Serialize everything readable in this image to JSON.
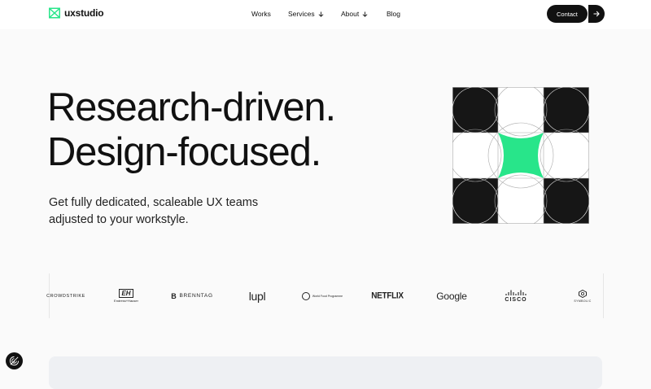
{
  "brand": {
    "name": "uxstudio",
    "accent_color": "#28e58a"
  },
  "nav": {
    "items": [
      {
        "label": "Works",
        "has_dropdown": false
      },
      {
        "label": "Services",
        "has_dropdown": true
      },
      {
        "label": "About",
        "has_dropdown": true
      },
      {
        "label": "Blog",
        "has_dropdown": false
      }
    ],
    "contact_label": "Contact",
    "contact_arrow_icon": "arrow-right-icon"
  },
  "hero": {
    "headline_line1": "Research-driven.",
    "headline_line2": "Design-focused.",
    "subtext": "Get fully dedicated, scaleable UX teams adjusted to your workstyle."
  },
  "client_logos": {
    "crowdstrike": "CROWDSTRIKE",
    "endress_mark": "EH",
    "endress": "Endress+Hauser",
    "brenntag": "BRENNTAG",
    "lupl": "lupl",
    "wfp": "World Food Programme",
    "netflix": "NETFLIX",
    "google": "Google",
    "cisco": "CISCO",
    "symbolic": "SYMBOLIC"
  },
  "cookie_settings_icon": "cookie-fingerprint-icon"
}
